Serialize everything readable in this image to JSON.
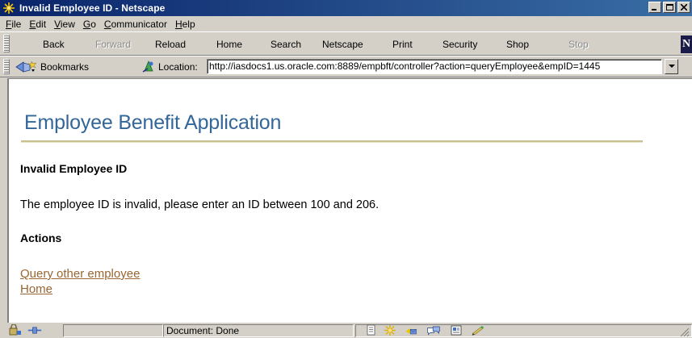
{
  "window": {
    "title": "Invalid Employee ID - Netscape"
  },
  "menu": {
    "items": [
      {
        "label": "File",
        "accel": "F",
        "rest": "ile"
      },
      {
        "label": "Edit",
        "accel": "E",
        "rest": "dit"
      },
      {
        "label": "View",
        "accel": "V",
        "rest": "iew"
      },
      {
        "label": "Go",
        "accel": "G",
        "rest": "o"
      },
      {
        "label": "Communicator",
        "accel": "C",
        "rest": "ommunicator"
      },
      {
        "label": "Help",
        "accel": "H",
        "rest": "elp"
      }
    ]
  },
  "nav_toolbar": {
    "back": "Back",
    "forward": "Forward",
    "reload": "Reload",
    "home": "Home",
    "search": "Search",
    "netscape": "Netscape",
    "print": "Print",
    "security": "Security",
    "shop": "Shop",
    "stop": "Stop",
    "logo": "N"
  },
  "location_toolbar": {
    "bookmarks_label": "Bookmarks",
    "location_label": "Location:",
    "url": "http://iasdocs1.us.oracle.com:8889/empbft/controller?action=queryEmployee&empID=1445"
  },
  "page": {
    "title": "Employee Benefit Application",
    "heading_invalid": "Invalid Employee ID",
    "message": "The employee ID is invalid, please enter an ID between 100 and 206.",
    "heading_actions": "Actions",
    "link_query": "Query other employee",
    "link_home": "Home"
  },
  "status_bar": {
    "text": "Document: Done"
  },
  "colors": {
    "title_blue": "#336699",
    "link_brown": "#996633",
    "rule_tan": "#c8c08e"
  }
}
